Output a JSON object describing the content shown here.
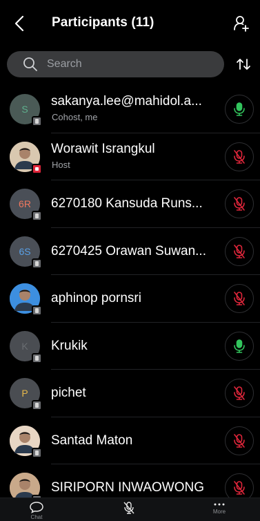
{
  "header": {
    "title": "Participants (11)"
  },
  "search": {
    "placeholder": "Search"
  },
  "colors": {
    "background": "#000000",
    "mic_on": "#32c55d",
    "mic_off": "#e0263b",
    "search_bg": "#3a3b3d"
  },
  "participants": [
    {
      "name": "sakanya.lee@mahidol.a...",
      "subtitle": "Cohost, me",
      "avatar_initials": "S",
      "avatar_color": "#4a5a56",
      "initials_color": "#5fb08d",
      "mic": "on"
    },
    {
      "name": "Worawit Israngkul",
      "subtitle": "Host",
      "avatar_initials": "",
      "avatar_color": "#d9c8b0",
      "initials_color": "#ffffff",
      "mic": "off"
    },
    {
      "name": "6270180 Kansuda Runs...",
      "subtitle": "",
      "avatar_initials": "6R",
      "avatar_color": "#4a4f57",
      "initials_color": "#f0785f",
      "mic": "off"
    },
    {
      "name": "6270425 Orawan Suwan...",
      "subtitle": "",
      "avatar_initials": "6S",
      "avatar_color": "#4a4f57",
      "initials_color": "#5aa0e6",
      "mic": "off"
    },
    {
      "name": "aphinop pornsri",
      "subtitle": "",
      "avatar_initials": "",
      "avatar_color": "#3d8fe0",
      "initials_color": "#ffffff",
      "mic": "off"
    },
    {
      "name": "Krukik",
      "subtitle": "",
      "avatar_initials": "K",
      "avatar_color": "#4a4d52",
      "initials_color": "#6a6d72",
      "mic": "on"
    },
    {
      "name": "pichet",
      "subtitle": "",
      "avatar_initials": "P",
      "avatar_color": "#4a4d52",
      "initials_color": "#e6b84a",
      "mic": "off"
    },
    {
      "name": "Santad Maton",
      "subtitle": "",
      "avatar_initials": "",
      "avatar_color": "#e8d6c4",
      "initials_color": "#ffffff",
      "mic": "off"
    },
    {
      "name": "SIRIPORN INWAOWONG",
      "subtitle": "",
      "avatar_initials": "",
      "avatar_color": "#c9a98a",
      "initials_color": "#ffffff",
      "mic": "off"
    }
  ],
  "bottom_bar": {
    "items": [
      {
        "icon": "chat-icon",
        "label": "Chat"
      },
      {
        "icon": "mic-off-icon",
        "label": ""
      },
      {
        "icon": "more-icon",
        "label": "More"
      }
    ]
  }
}
